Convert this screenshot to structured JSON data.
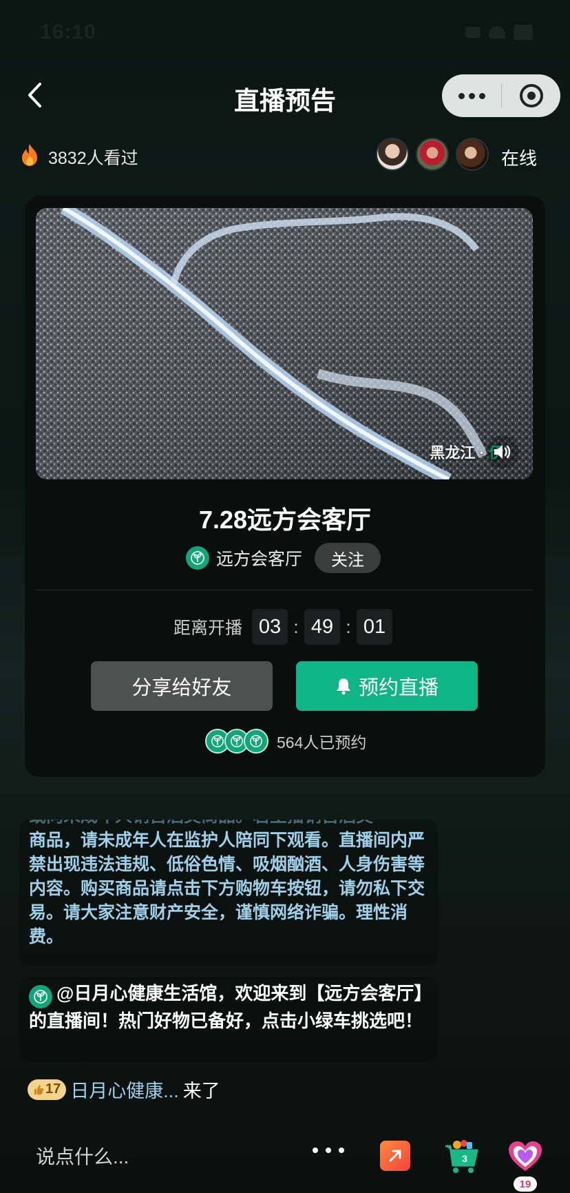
{
  "status_bar": {
    "time": "16:10"
  },
  "header": {
    "title": "直播预告"
  },
  "viewers": {
    "count_text": "3832人看过",
    "online_label": "在线"
  },
  "video": {
    "caption": "黑龙江 · ",
    "caption_tag": "伊"
  },
  "live": {
    "title": "7.28远方会客厅",
    "host_name": "远方会客厅",
    "follow_label": "关注"
  },
  "countdown": {
    "label": "距离开播",
    "hours": "03",
    "minutes": "49",
    "seconds": "01",
    "separator": ":"
  },
  "actions": {
    "share_label": "分享给好友",
    "reserve_label": "预约直播"
  },
  "reserved": {
    "text": "564人已预约"
  },
  "chat": {
    "notice_partial": "或向未成年人销售酒类商品。若主播销售酒类",
    "notice": "商品，请未成年人在监护人陪同下观看。直播间内严禁出现违法违规、低俗色情、吸烟酗酒、人身伤害等内容。购买商品请点击下方购物车按钮，请勿私下交易。请大家注意财产安全，谨慎网络诈骗。理性消费。",
    "welcome": "@日月心健康生活馆，欢迎来到【远方会客厅】的直播间！热门好物已备好，点击小绿车挑选吧！",
    "join_level": "17",
    "join_name": "日月心健康...",
    "join_action": "来了"
  },
  "bottom_bar": {
    "comment_placeholder": "说点什么...",
    "cart_count": "3",
    "like_count": "19"
  },
  "colors": {
    "accent": "#10b587",
    "link": "#9fd0ea",
    "like": "#e1336a"
  }
}
